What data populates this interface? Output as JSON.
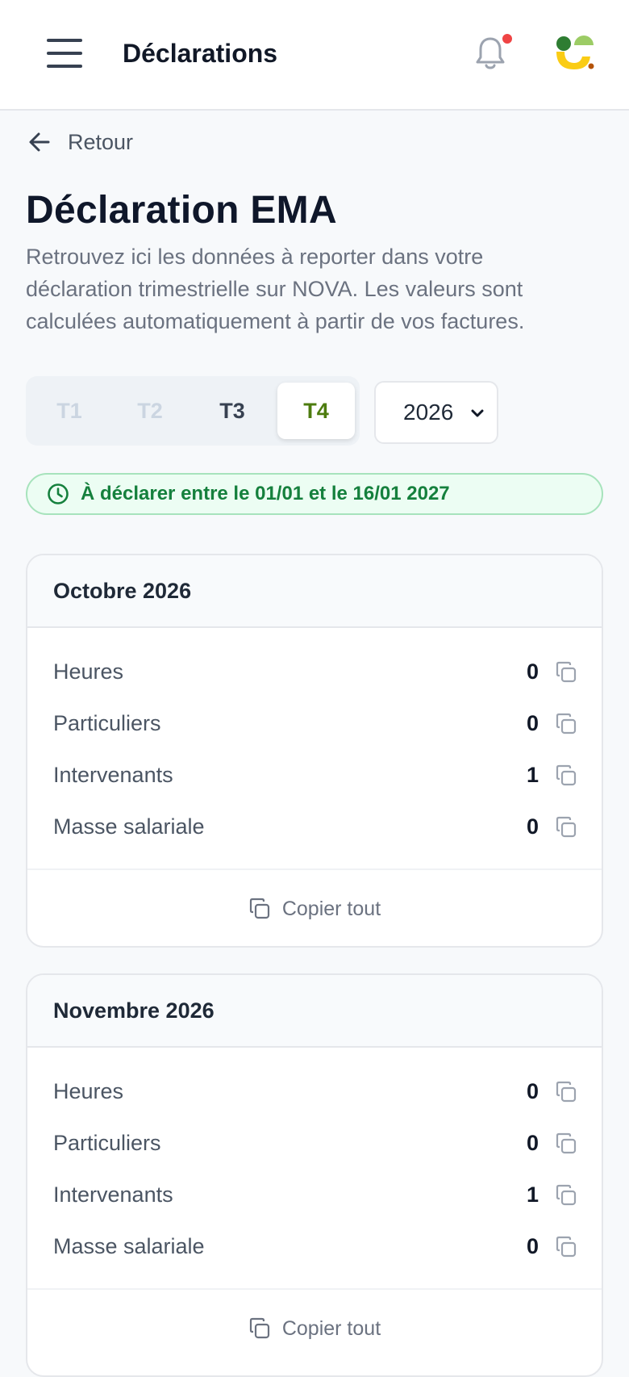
{
  "header": {
    "title": "Déclarations"
  },
  "back": {
    "label": "Retour"
  },
  "page": {
    "title": "Déclaration EMA",
    "description": "Retrouvez ici les données à reporter dans votre déclaration trimestrielle sur NOVA. Les valeurs sont calculées automatiquement à partir de vos factures."
  },
  "quarters": [
    {
      "label": "T1",
      "state": "disabled"
    },
    {
      "label": "T2",
      "state": "disabled"
    },
    {
      "label": "T3",
      "state": "normal"
    },
    {
      "label": "T4",
      "state": "active"
    }
  ],
  "year": {
    "selected": "2026"
  },
  "notice": {
    "text": "À déclarer entre le 01/01 et le 16/01 2027"
  },
  "months": [
    {
      "title": "Octobre 2026",
      "rows": [
        {
          "label": "Heures",
          "value": "0"
        },
        {
          "label": "Particuliers",
          "value": "0"
        },
        {
          "label": "Intervenants",
          "value": "1"
        },
        {
          "label": "Masse salariale",
          "value": "0"
        }
      ],
      "copy_all": "Copier tout"
    },
    {
      "title": "Novembre 2026",
      "rows": [
        {
          "label": "Heures",
          "value": "0"
        },
        {
          "label": "Particuliers",
          "value": "0"
        },
        {
          "label": "Intervenants",
          "value": "1"
        },
        {
          "label": "Masse salariale",
          "value": "0"
        }
      ],
      "copy_all": "Copier tout"
    }
  ],
  "colors": {
    "accent_green": "#15803d",
    "active_quarter": "#4d7c0f",
    "notification": "#ef4444"
  },
  "icons": [
    "menu-icon",
    "bell-icon",
    "arrow-left-icon",
    "chevron-down-icon",
    "clock-icon",
    "copy-icon"
  ]
}
